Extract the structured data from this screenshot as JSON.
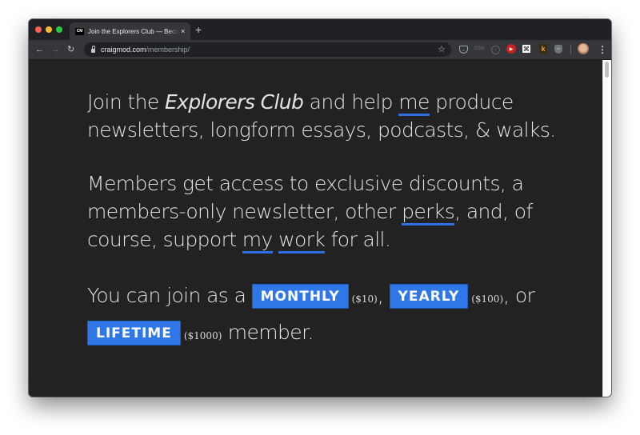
{
  "browser": {
    "tab": {
      "favicon_text": "CM",
      "title": "Join the Explorers Club — Become a member",
      "close_icon": "×"
    },
    "new_tab_icon": "+",
    "nav": {
      "back_icon": "←",
      "forward_icon": "→",
      "reload_icon": "↻"
    },
    "address_bar": {
      "domain": "craigmod.com",
      "path": "/membership/"
    },
    "bookmark_icon": "☆",
    "extensions": [
      {
        "name": "pocket",
        "glyph": "⌄"
      },
      {
        "name": "css",
        "glyph": "CSS"
      },
      {
        "name": "info",
        "glyph": "i"
      },
      {
        "name": "youtube",
        "glyph": "▶"
      },
      {
        "name": "grid",
        "glyph": "⌘"
      },
      {
        "name": "k",
        "glyph": "k"
      },
      {
        "name": "shield",
        "glyph": "ᵒᵒ"
      }
    ],
    "menu_icon": "⋮"
  },
  "page": {
    "para1": {
      "pre": "Join the ",
      "italic": "Explorers Club",
      "mid": " and help ",
      "link_me": "me",
      "post": " produce newsletters, longform essays, podcasts, & walks."
    },
    "para2": {
      "pre": "Members get access to exclusive discounts, a members-only newsletter, other ",
      "link_perks": "perks",
      "mid": ", and, of course, support ",
      "link_my": "my",
      "space": " ",
      "link_work": "work",
      "post": " for all."
    },
    "para3": {
      "pre": "You can join as a ",
      "tiers": [
        {
          "label": "MONTHLY",
          "price": "($10)",
          "after": ", "
        },
        {
          "label": "YEARLY",
          "price": "($100)",
          "after": ", or "
        },
        {
          "label": "LIFETIME",
          "price": "($1000)",
          "after": " member."
        }
      ]
    }
  },
  "colors": {
    "background": "#222222",
    "text": "#e3e3e3",
    "link_underline": "#2f6fe4",
    "tier_button": "#2f76e6"
  }
}
